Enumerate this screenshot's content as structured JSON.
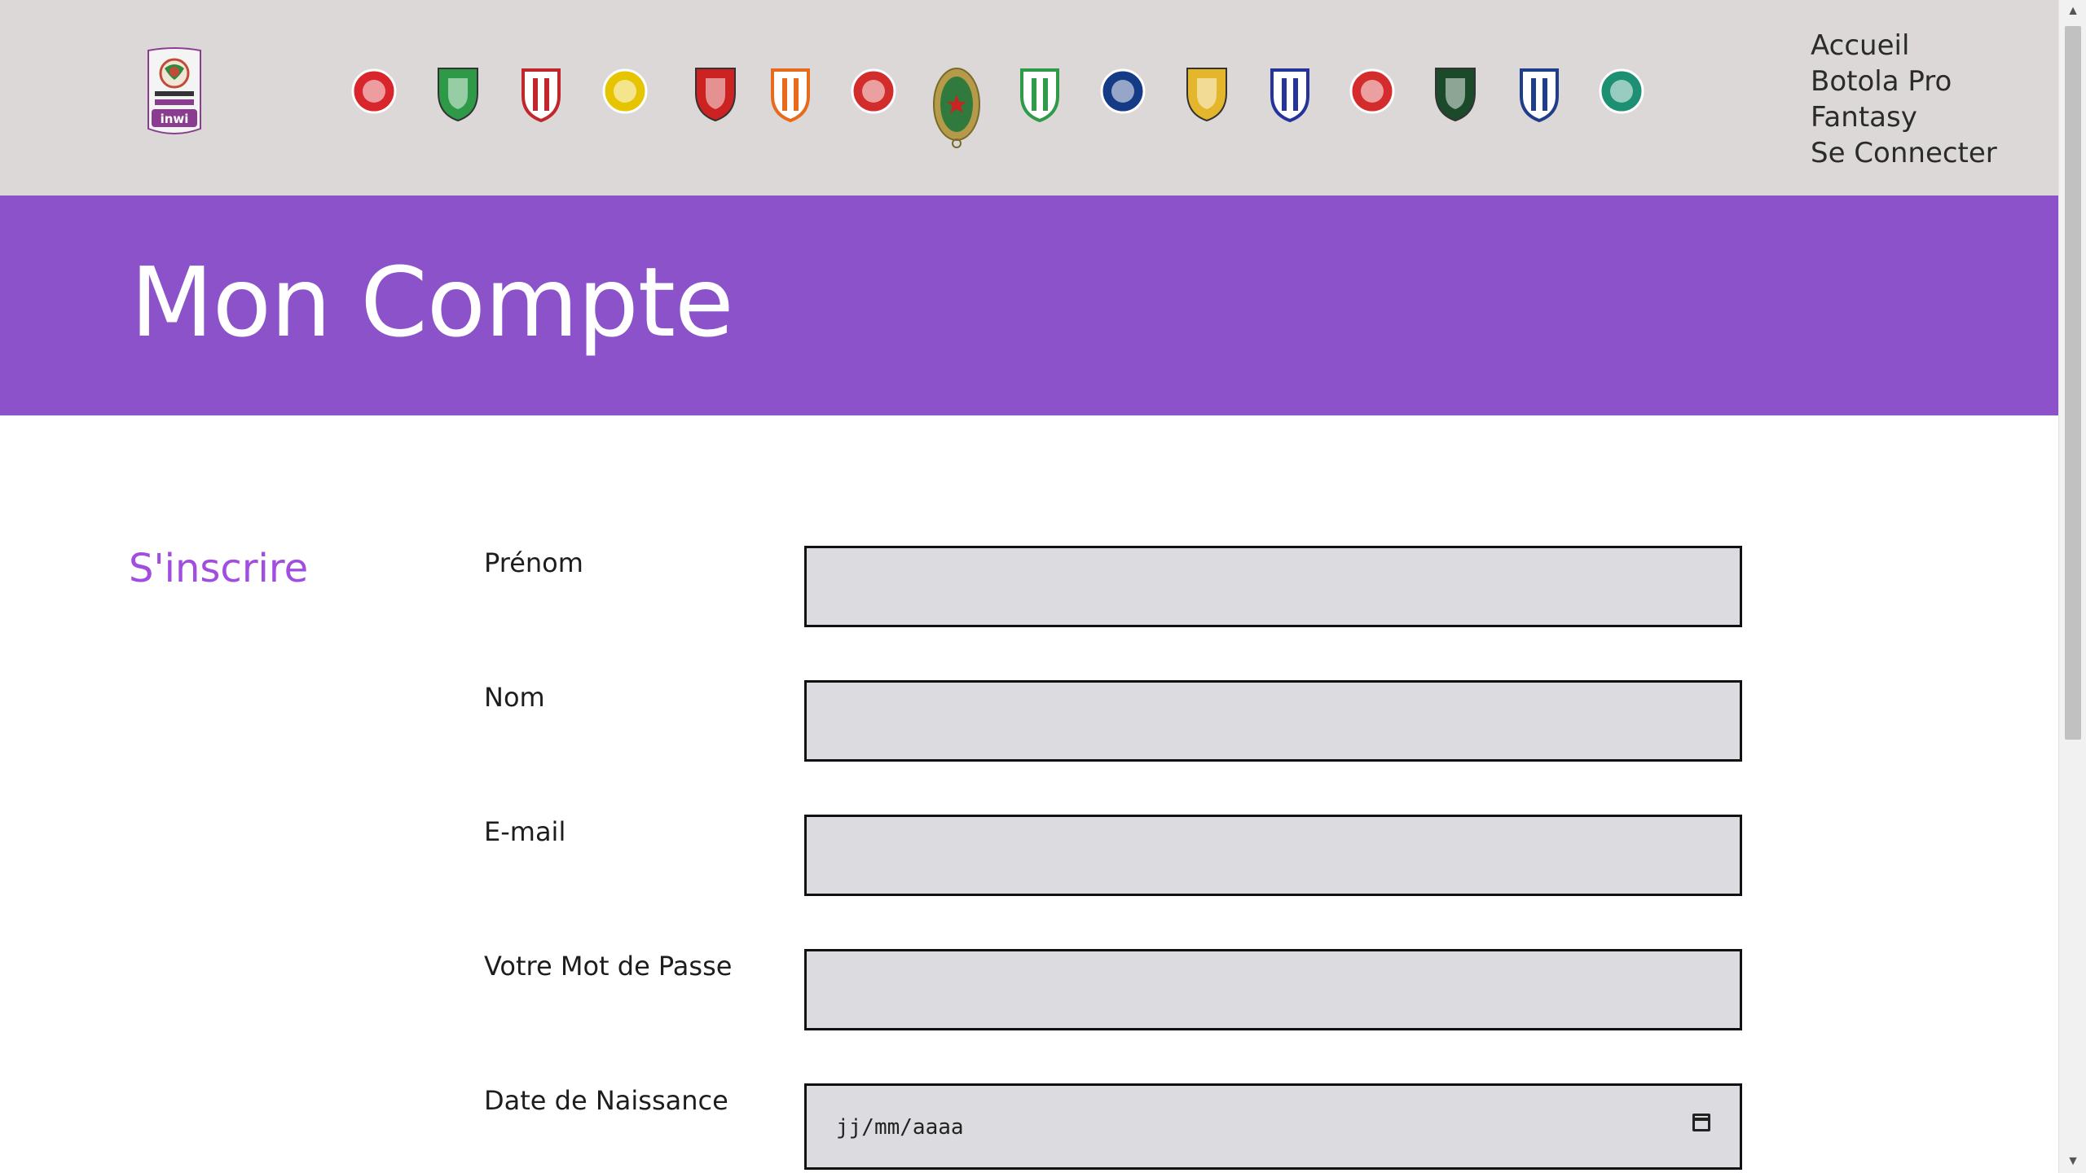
{
  "nav": {
    "items": [
      "Accueil",
      "Botola Pro",
      "Fantasy",
      "Se Connecter"
    ]
  },
  "logo": {
    "icon": "botola-pro-inwi-logo",
    "brand_color": "#8a3d8f"
  },
  "clubs": [
    {
      "icon": "wac-crest",
      "color": "#d8262c"
    },
    {
      "icon": "raja-crest",
      "color": "#2e9a48"
    },
    {
      "icon": "mat-crest",
      "color": "#c0262c"
    },
    {
      "icon": "mas-crest",
      "color": "#e7c400"
    },
    {
      "icon": "chabab-crest",
      "color": "#cc2222"
    },
    {
      "icon": "rsb-crest",
      "color": "#e76b1b"
    },
    {
      "icon": "fus-crest",
      "color": "#d22c2c"
    },
    {
      "icon": "far-crest",
      "color": "#2f7a3c"
    },
    {
      "icon": "difaa-crest",
      "color": "#2f9a48"
    },
    {
      "icon": "soualem-crest",
      "color": "#163b86"
    },
    {
      "icon": "olympic-crest",
      "color": "#e4b62b"
    },
    {
      "icon": "irt-crest",
      "color": "#25349a"
    },
    {
      "icon": "husa-crest",
      "color": "#d42c2c"
    },
    {
      "icon": "jss-crest",
      "color": "#1b4a2a"
    },
    {
      "icon": "mco-crest",
      "color": "#1f3d8a"
    },
    {
      "icon": "ocs-crest",
      "color": "#1d8f73"
    }
  ],
  "banner": {
    "title": "Mon Compte",
    "color": "#8c52c9"
  },
  "form": {
    "title": "S'inscrire",
    "fields": [
      {
        "label": "Prénom",
        "value": ""
      },
      {
        "label": "Nom",
        "value": ""
      },
      {
        "label": "E-mail",
        "value": ""
      },
      {
        "label": "Votre Mot de Passe",
        "value": ""
      },
      {
        "label": "Date de Naissance",
        "placeholder": "jj/mm/aaaa",
        "icon": "calendar-icon"
      }
    ]
  },
  "colors": {
    "accent": "#a14de0",
    "header_bg": "#dcd8d8",
    "field_bg": "#dcdbe0"
  }
}
